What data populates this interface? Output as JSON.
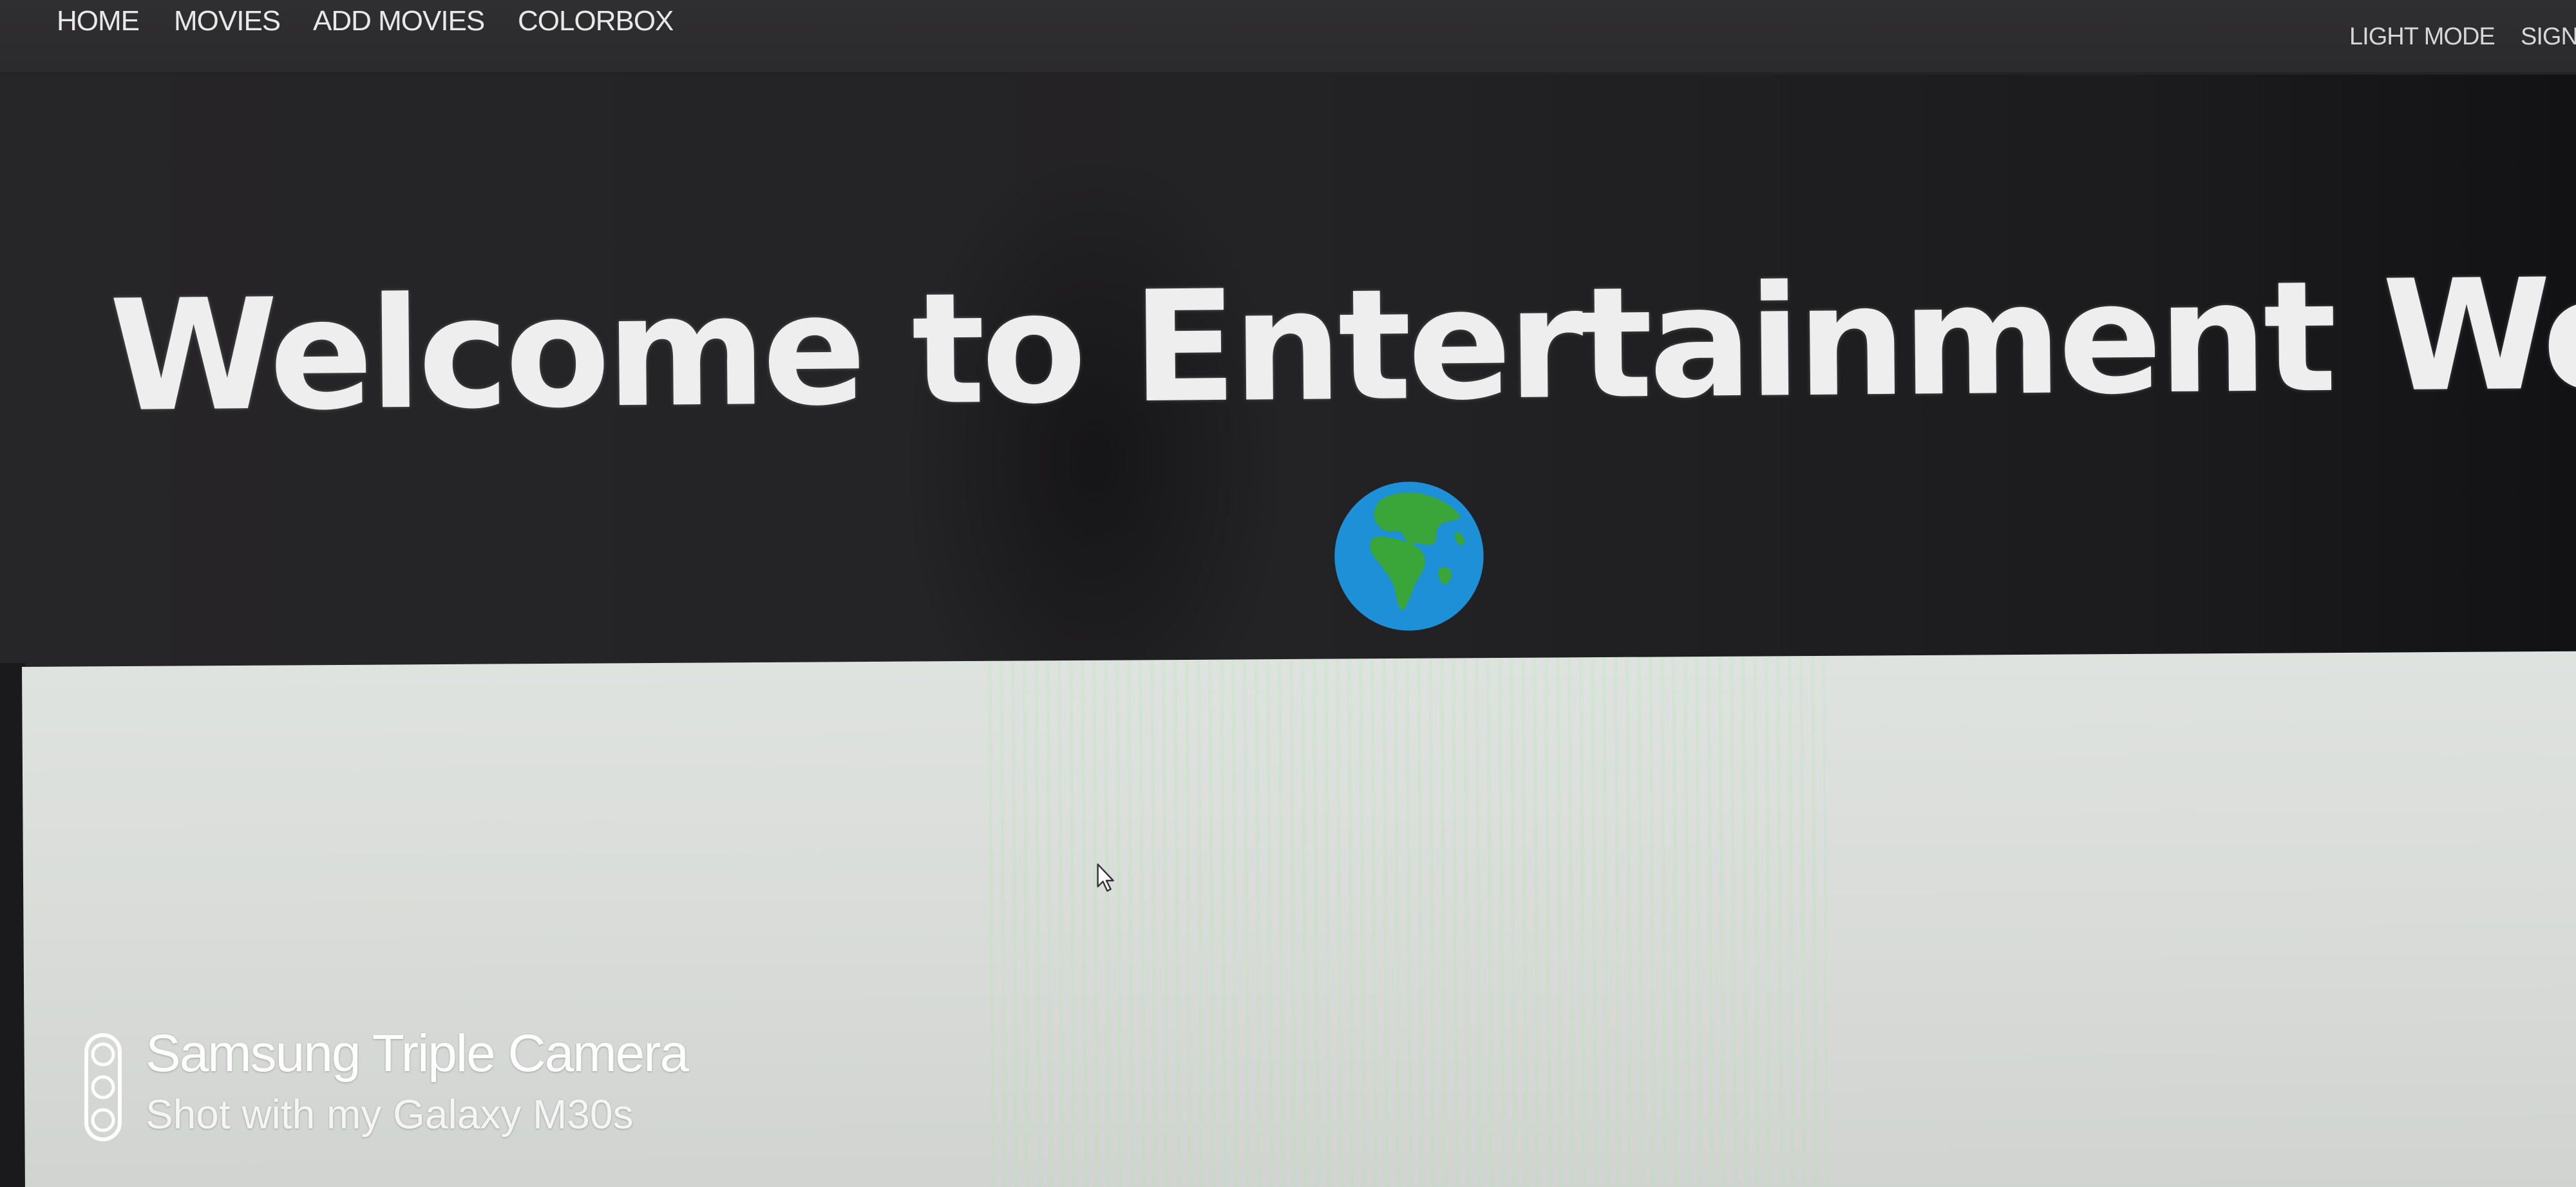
{
  "nav": {
    "left_links": [
      {
        "label": "HOME"
      },
      {
        "label": "MOVIES"
      },
      {
        "label": "ADD MOVIES"
      },
      {
        "label": "COLORBOX"
      }
    ],
    "light_mode_label": "LIGHT MODE",
    "sign_label": "SIGN"
  },
  "hero": {
    "title": "Welcome to Entertainment World",
    "icon": "globe-icon"
  },
  "watermark": {
    "line1": "Samsung Triple Camera",
    "line2": "Shot with my Galaxy M30s",
    "icon": "triple-camera-icon"
  },
  "colors": {
    "navbar_bg": "#2f2e30",
    "hero_bg": "#232224",
    "hero_text": "#eeeeee",
    "content_bg": "#dfe3e0",
    "globe_ocean": "#1e90d8",
    "globe_land": "#3aa63a"
  }
}
